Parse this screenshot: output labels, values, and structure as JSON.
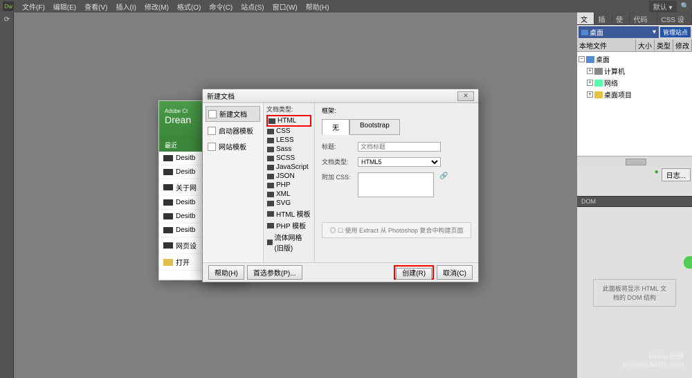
{
  "menubar": {
    "logo": "Dw",
    "items": [
      "文件(F)",
      "编辑(E)",
      "查看(V)",
      "插入(I)",
      "修改(M)",
      "格式(O)",
      "命令(C)",
      "站点(S)",
      "窗口(W)",
      "帮助(H)"
    ],
    "login": "默认 ▾"
  },
  "right_panel": {
    "tabs": [
      "文件",
      "插入",
      "使用",
      "代码片断",
      "CSS 设计器"
    ],
    "active_tab": 0,
    "site_dropdown": "桌面",
    "manage": "管理站点",
    "columns": [
      "本地文件",
      "大小",
      "类型",
      "修改"
    ],
    "tree": {
      "root": "桌面",
      "children": [
        "计算机",
        "网络",
        "桌面项目"
      ]
    },
    "log_button": "日志..."
  },
  "dom_panel": {
    "header": "DOM",
    "message": "此面板将显示 HTML 文档的 DOM 结构"
  },
  "start": {
    "adobe": "Adobe Cr",
    "product": "Drean",
    "recent_header": "最近",
    "items": [
      "Desitb",
      "Desitb",
      "关于网",
      "Desitb",
      "Desitb",
      "Desitb",
      "网页设"
    ],
    "open": "打开"
  },
  "dialog": {
    "title": "新建文档",
    "pane1": [
      "新建文档",
      "启动器模板",
      "网站模板"
    ],
    "pane2_header": "文档类型:",
    "filetypes": [
      "HTML",
      "CSS",
      "LESS",
      "Sass",
      "SCSS",
      "JavaScript",
      "JSON",
      "PHP",
      "XML",
      "SVG",
      "HTML 模板",
      "PHP 模板",
      "流体网格 (旧版)"
    ],
    "pane3_header": "框架:",
    "framework_tabs": [
      "无",
      "Bootstrap"
    ],
    "title_label": "标题:",
    "title_placeholder": "文档标题",
    "doctype_label": "文档类型:",
    "doctype_value": "HTML5",
    "css_label": "附加 CSS:",
    "extract": "◎ ☐ 使用 Extract 从 Photoshop 复合中构建页面",
    "help": "帮助(H)",
    "prefs": "首选参数(P)...",
    "create": "创建(R)",
    "cancel": "取消(C)"
  },
  "watermark": {
    "brand": "Baidu 经验",
    "url": "jingyan.baidu.com"
  }
}
